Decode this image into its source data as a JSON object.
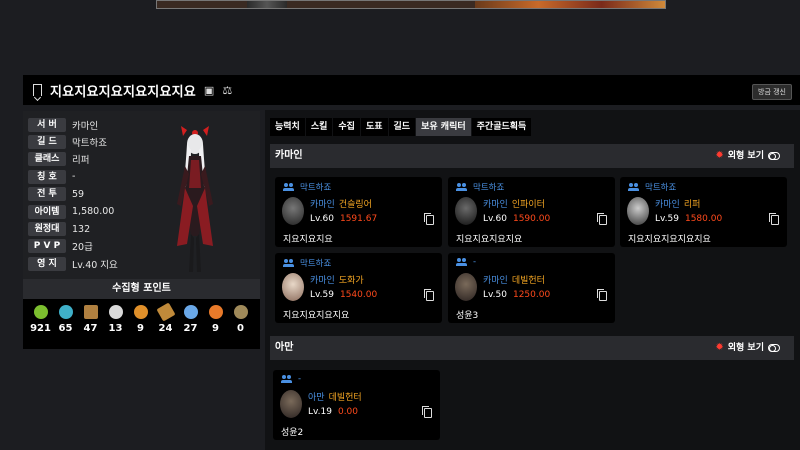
{
  "header": {
    "title": "지요지요지요지요지요지요",
    "renew_label": "방금 갱신"
  },
  "profile": {
    "stats": [
      {
        "key": "서 버",
        "value": "카마인"
      },
      {
        "key": "길 드",
        "value": "막트하죠"
      },
      {
        "key": "클래스",
        "value": "리퍼"
      },
      {
        "key": "칭 호",
        "value": "-"
      },
      {
        "key": "전 투",
        "value": "59"
      },
      {
        "key": "아이템",
        "value": "1,580.00"
      },
      {
        "key": "원정대",
        "value": "132"
      },
      {
        "key": "P V P",
        "value": "20급"
      },
      {
        "key": "영 지",
        "value": "Lv.40 지요"
      }
    ]
  },
  "collect": {
    "title": "수집형 포인트",
    "items": [
      {
        "icon": "mokoko-seed-icon",
        "color": "#7cbf2f",
        "value": "921"
      },
      {
        "icon": "island-heart-icon",
        "color": "#3fb0c9",
        "value": "65"
      },
      {
        "icon": "great-art-icon",
        "color": "#b08040",
        "value": "47"
      },
      {
        "icon": "giant-heart-icon",
        "color": "#d9d9d9",
        "value": "13"
      },
      {
        "icon": "ignea-token-icon",
        "color": "#e0902a",
        "value": "9"
      },
      {
        "icon": "adventure-tome-icon",
        "color": "#c08a3a",
        "value": "24"
      },
      {
        "icon": "sea-bounty-icon",
        "color": "#6aa8e8",
        "value": "27"
      },
      {
        "icon": "world-tree-leaf-icon",
        "color": "#e87a2a",
        "value": "9"
      },
      {
        "icon": "orpheus-star-icon",
        "color": "#a08a5a",
        "value": "0"
      }
    ]
  },
  "tabs": [
    {
      "label": "능력치"
    },
    {
      "label": "스킬"
    },
    {
      "label": "수집"
    },
    {
      "label": "도표"
    },
    {
      "label": "길드"
    },
    {
      "label": "보유 캐릭터",
      "active": true
    },
    {
      "label": "주간골드획득"
    }
  ],
  "servers": [
    {
      "name": "카마인",
      "look_label": "외형 보기",
      "characters": [
        {
          "guild": "막트하죠",
          "server": "카마인",
          "class": "건슬링어",
          "level": "Lv.60",
          "item_level": "1591.67",
          "name": "지요지요지요"
        },
        {
          "guild": "막트하죠",
          "server": "카마인",
          "class": "인파이터",
          "level": "Lv.60",
          "item_level": "1590.00",
          "name": "지요지요지요지요"
        },
        {
          "guild": "막트하죠",
          "server": "카마인",
          "class": "리퍼",
          "level": "Lv.59",
          "item_level": "1580.00",
          "name": "지요지요지요지요지요"
        },
        {
          "guild": "막트하죠",
          "server": "카마인",
          "class": "도화가",
          "level": "Lv.59",
          "item_level": "1540.00",
          "name": "지요지요지요지요"
        },
        {
          "guild": "-",
          "server": "카마인",
          "class": "데빌헌터",
          "level": "Lv.50",
          "item_level": "1250.00",
          "name": "성윤3"
        }
      ]
    },
    {
      "name": "아만",
      "look_label": "외형 보기",
      "characters": [
        {
          "guild": "-",
          "server": "아만",
          "class": "데빌헌터",
          "level": "Lv.19",
          "item_level": "0.00",
          "name": "성윤2"
        }
      ]
    }
  ]
}
